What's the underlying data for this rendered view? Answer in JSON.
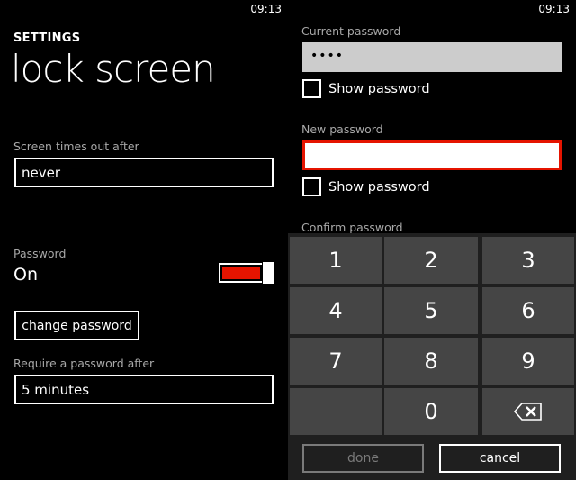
{
  "status_bar": {
    "time": "09:13"
  },
  "settings_screen": {
    "app_title": "SETTINGS",
    "page_title": "lock screen",
    "screen_timeout": {
      "label": "Screen times out after",
      "value": "never"
    },
    "password": {
      "label": "Password",
      "state": "On",
      "toggle_on": true
    },
    "change_password_button": "change password",
    "require_password": {
      "label": "Require a password after",
      "value": "5 minutes"
    }
  },
  "change_password_screen": {
    "current_password": {
      "label": "Current password",
      "masked_value": "••••",
      "show_password_label": "Show password",
      "show_password_checked": false
    },
    "new_password": {
      "label": "New password",
      "value": "",
      "show_password_label": "Show password",
      "show_password_checked": false
    },
    "confirm_password": {
      "label": "Confirm password"
    },
    "keypad": {
      "keys": [
        "1",
        "2",
        "3",
        "4",
        "5",
        "6",
        "7",
        "8",
        "9",
        "",
        "0",
        "backspace"
      ],
      "backspace_icon": "backspace-icon",
      "done_label": "done",
      "done_enabled": false,
      "cancel_label": "cancel"
    }
  },
  "colors": {
    "accent": "#e51400",
    "keypad_bg": "#1f1f1f",
    "key_bg": "#454545",
    "label_gray": "#a8a8a8"
  }
}
